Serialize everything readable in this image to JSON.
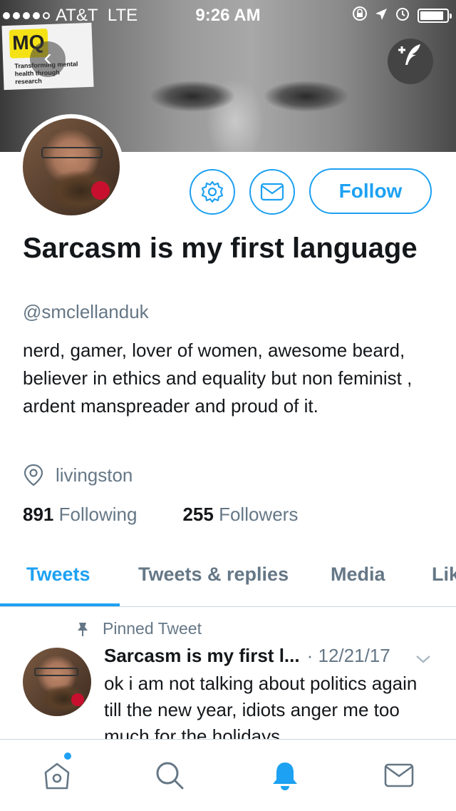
{
  "status_bar": {
    "carrier": "AT&T",
    "network": "LTE",
    "time": "9:26 AM",
    "signal_bars_filled": 4,
    "signal_bars_total": 5,
    "battery_level": 0.9
  },
  "header": {
    "logo_text": "MQ",
    "logo_tagline": "Transforming mental health through research",
    "back_icon": "chevron-left-icon",
    "compose_icon": "compose-tweet-icon"
  },
  "profile": {
    "display_name": "Sarcasm is my first language",
    "handle": "@smclellanduk",
    "bio": "nerd, gamer, lover of women, awesome beard, believer in ethics and equality but non feminist , ardent manspreader and proud of it.",
    "location": "livingston",
    "following_count": "891",
    "following_label": "Following",
    "followers_count": "255",
    "followers_label": "Followers"
  },
  "actions": {
    "settings_icon": "gear-icon",
    "message_icon": "envelope-icon",
    "follow_label": "Follow"
  },
  "tabs": [
    {
      "label": "Tweets",
      "active": true
    },
    {
      "label": "Tweets & replies",
      "active": false
    },
    {
      "label": "Media",
      "active": false
    },
    {
      "label": "Lik",
      "active": false
    }
  ],
  "pinned_tweet": {
    "pinned_label": "Pinned Tweet",
    "author": "Sarcasm is my first l...",
    "date": "12/21/17",
    "separator": "·",
    "text": "ok i am not talking about politics again till the new year, idiots anger me too much for the holidays"
  },
  "bottom_nav": {
    "items": [
      "home-icon",
      "search-icon",
      "notifications-icon",
      "messages-icon"
    ]
  },
  "colors": {
    "accent": "#1da1f2",
    "secondary_text": "#657786"
  }
}
